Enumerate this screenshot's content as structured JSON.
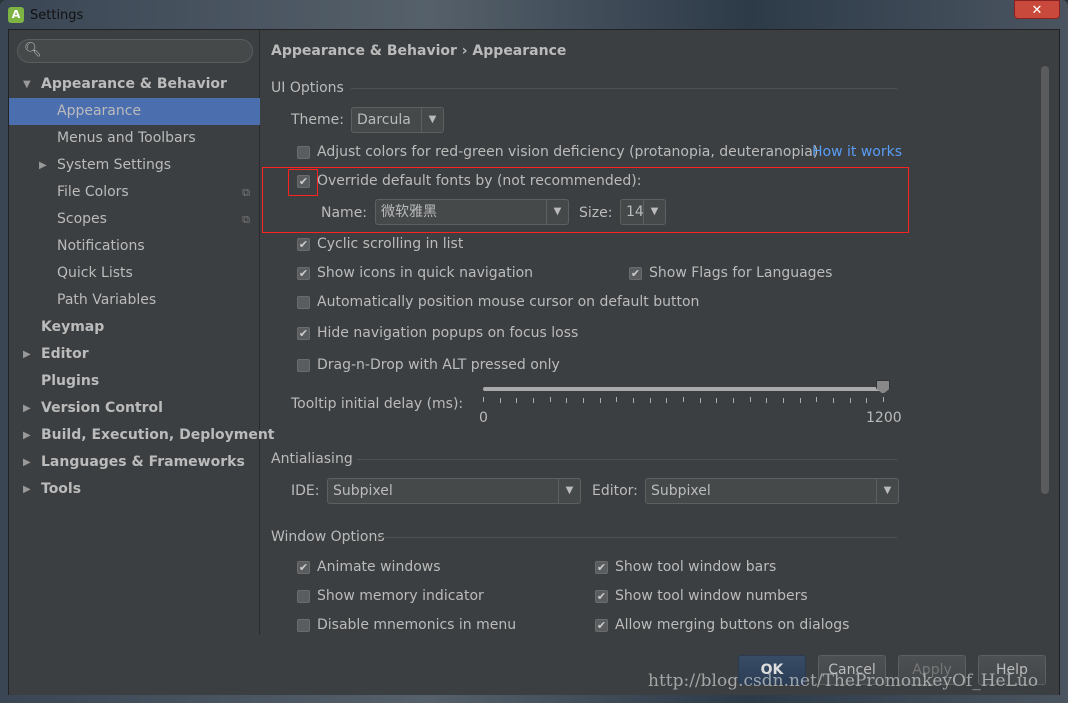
{
  "window": {
    "title": "Settings",
    "close": "✕"
  },
  "sidebar": {
    "items": [
      {
        "label": "Appearance & Behavior",
        "level": 0,
        "bold": true,
        "arrow": "▼"
      },
      {
        "label": "Appearance",
        "level": 1,
        "selected": true
      },
      {
        "label": "Menus and Toolbars",
        "level": 1
      },
      {
        "label": "System Settings",
        "level": 1,
        "arrow": "▶"
      },
      {
        "label": "File Colors",
        "level": 1,
        "copy": true
      },
      {
        "label": "Scopes",
        "level": 1,
        "copy": true
      },
      {
        "label": "Notifications",
        "level": 1
      },
      {
        "label": "Quick Lists",
        "level": 1
      },
      {
        "label": "Path Variables",
        "level": 1
      },
      {
        "label": "Keymap",
        "level": 0,
        "bold": true
      },
      {
        "label": "Editor",
        "level": 0,
        "bold": true,
        "arrow": "▶"
      },
      {
        "label": "Plugins",
        "level": 0,
        "bold": true
      },
      {
        "label": "Version Control",
        "level": 0,
        "bold": true,
        "arrow": "▶"
      },
      {
        "label": "Build, Execution, Deployment",
        "level": 0,
        "bold": true,
        "arrow": "▶"
      },
      {
        "label": "Languages & Frameworks",
        "level": 0,
        "bold": true,
        "arrow": "▶"
      },
      {
        "label": "Tools",
        "level": 0,
        "bold": true,
        "arrow": "▶"
      }
    ]
  },
  "main": {
    "breadcrumb": "Appearance & Behavior › Appearance",
    "ui_options": "UI Options",
    "theme_label": "Theme:",
    "theme_value": "Darcula",
    "adjust_colors": "Adjust colors for red-green vision deficiency (protanopia, deuteranopia)",
    "how_it_works": "How it works",
    "override_fonts": "Override default fonts by (not recommended):",
    "name_label": "Name:",
    "name_value": "微软雅黑",
    "size_label": "Size:",
    "size_value": "14",
    "cyclic": "Cyclic scrolling in list",
    "show_icons": "Show icons in quick navigation",
    "show_flags": "Show Flags for Languages",
    "auto_position": "Automatically position mouse cursor on default button",
    "hide_nav": "Hide navigation popups on focus loss",
    "drag_drop": "Drag-n-Drop with ALT pressed only",
    "tooltip_label": "Tooltip initial delay (ms):",
    "tooltip_min": "0",
    "tooltip_max": "1200",
    "tooltip_value": 1200,
    "antialiasing": "Antialiasing",
    "ide_label": "IDE:",
    "ide_value": "Subpixel",
    "editor_label": "Editor:",
    "editor_value": "Subpixel",
    "window_options": "Window Options",
    "animate": "Animate windows",
    "memory": "Show memory indicator",
    "mnemonics": "Disable mnemonics in menu",
    "tool_bars": "Show tool window bars",
    "tool_numbers": "Show tool window numbers",
    "merging": "Allow merging buttons on dialogs"
  },
  "buttons": {
    "ok": "OK",
    "cancel": "Cancel",
    "apply": "Apply",
    "help": "Help"
  },
  "watermark": "http://blog.csdn.net/ThePromonkeyOf_HeLuo",
  "colors": {
    "background": "#3c3f41",
    "selection": "#4b6eaf",
    "link": "#589df6",
    "highlight": "#ff2020"
  }
}
